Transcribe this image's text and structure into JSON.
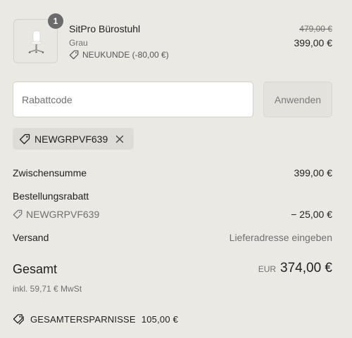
{
  "product": {
    "quantity": "1",
    "name": "SitPro Bürostuhl",
    "variant": "Grau",
    "discount_label": "NEUKUNDE (-80,00 €)",
    "original_price": "479,00 €",
    "price": "399,00 €",
    "image_icon": "office-chair-icon"
  },
  "discount_form": {
    "placeholder": "Rabattcode",
    "value": "",
    "apply_label": "Anwenden"
  },
  "applied_code": {
    "code": "NEWGRPVF639",
    "tag_icon": "tag-icon",
    "remove_icon": "close-icon"
  },
  "summary": {
    "subtotal_label": "Zwischensumme",
    "subtotal_value": "399,00 €",
    "order_discount_label": "Bestellungsrabatt",
    "order_discount_code": "NEWGRPVF639",
    "order_discount_value": "− 25,00 €",
    "shipping_label": "Versand",
    "shipping_value": "Lieferadresse eingeben",
    "total_label": "Gesamt",
    "total_currency": "EUR",
    "total_value": "374,00 €",
    "tax_note": "inkl. 59,71 € MwSt",
    "savings_label": "GESAMTERSPARNISSE",
    "savings_value": "105,00 €"
  },
  "colors": {
    "background": "#ebe9e4",
    "text": "#1f1f1f",
    "muted_text": "#707070",
    "badge": "#6b6b6b"
  }
}
